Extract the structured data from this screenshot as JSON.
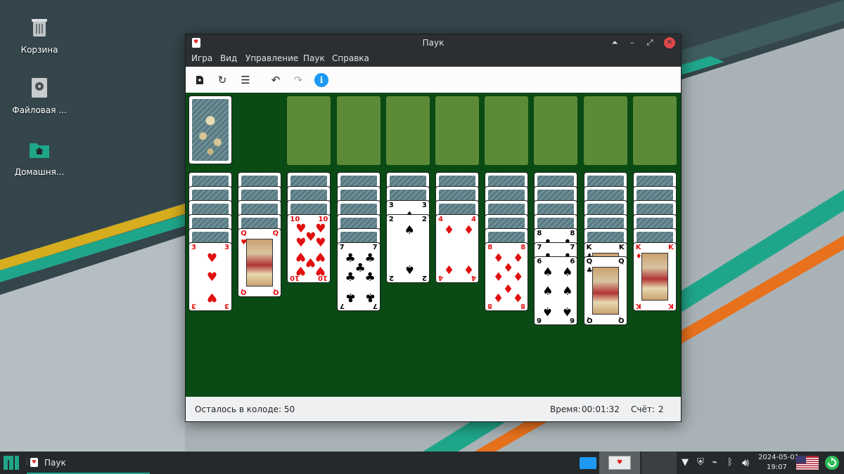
{
  "desktop": {
    "icons": [
      {
        "label": "Корзина",
        "icon": "trash-icon"
      },
      {
        "label": "Файловая ...",
        "icon": "drive-icon"
      },
      {
        "label": "Домашня...",
        "icon": "home-folder-icon"
      }
    ]
  },
  "window": {
    "title": "Паук",
    "menu": [
      "Игра",
      "Вид",
      "Управление",
      "Паук",
      "Справка"
    ],
    "toolbar": [
      "new-game-icon",
      "restart-icon",
      "list-icon",
      "undo-icon",
      "redo-icon",
      "info-icon"
    ],
    "info_glyph": "i"
  },
  "game": {
    "stock_count": 50,
    "foundation_slots": 8,
    "columns": [
      {
        "hidden": 5,
        "up": [
          {
            "r": "3",
            "s": "♥"
          }
        ]
      },
      {
        "hidden": 4,
        "up": [
          {
            "r": "Q",
            "s": "♥"
          }
        ]
      },
      {
        "hidden": 3,
        "up": [
          {
            "r": "10",
            "s": "♥"
          }
        ]
      },
      {
        "hidden": 5,
        "up": [
          {
            "r": "7",
            "s": "♣"
          }
        ]
      },
      {
        "hidden": 2,
        "up": [
          {
            "r": "3",
            "s": "♠"
          },
          {
            "r": "2",
            "s": "♠"
          }
        ]
      },
      {
        "hidden": 3,
        "up": [
          {
            "r": "4",
            "s": "♦"
          }
        ]
      },
      {
        "hidden": 5,
        "up": [
          {
            "r": "8",
            "s": "♦"
          }
        ]
      },
      {
        "hidden": 4,
        "up": [
          {
            "r": "8",
            "s": "♣"
          },
          {
            "r": "7",
            "s": "♣"
          },
          {
            "r": "6",
            "s": "♠"
          }
        ]
      },
      {
        "hidden": 5,
        "up": [
          {
            "r": "K",
            "s": "♣"
          },
          {
            "r": "Q",
            "s": "♣"
          }
        ]
      },
      {
        "hidden": 5,
        "up": [
          {
            "r": "K",
            "s": "♦"
          }
        ]
      }
    ]
  },
  "status": {
    "remaining_label": "Осталось в колоде: 50",
    "time_label": "Время:",
    "time_value": "00:01:32",
    "score_label": "Счёт:",
    "score_value": "2"
  },
  "taskbar": {
    "task_label": "Паук",
    "date": "2024-05-01",
    "time": "19:07"
  },
  "colors": {
    "felt": "#0a4a14",
    "slot": "#5c8a37",
    "accent": "#1fa68a",
    "close": "#e0474a"
  }
}
